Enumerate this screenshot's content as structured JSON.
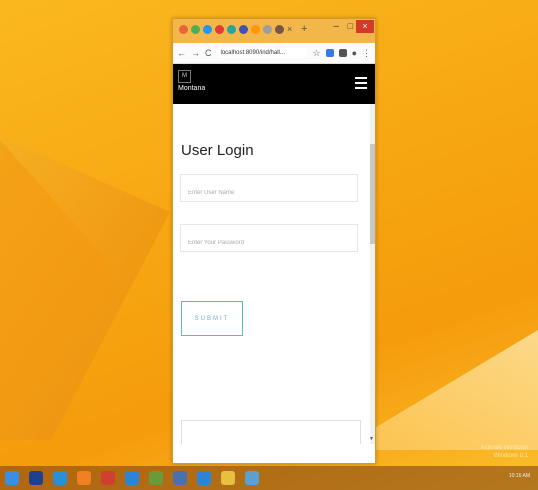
{
  "browser": {
    "url": "localhost:8090/ind/hall...",
    "tab_close": "×",
    "tab_new": "+",
    "minimize": "–",
    "maximize": "□",
    "close": "×"
  },
  "navbar": {
    "logo_letter": "M",
    "brand": "Montana"
  },
  "login": {
    "title": "User Login",
    "username_placeholder": "Enter User Name",
    "password_placeholder": "Enter Your Password",
    "submit_label": "SUBMIT"
  },
  "desktop": {
    "watermark_line1": "Activate Windows",
    "watermark_line2": "Windows 8.1",
    "clock": "10:16 AM"
  }
}
